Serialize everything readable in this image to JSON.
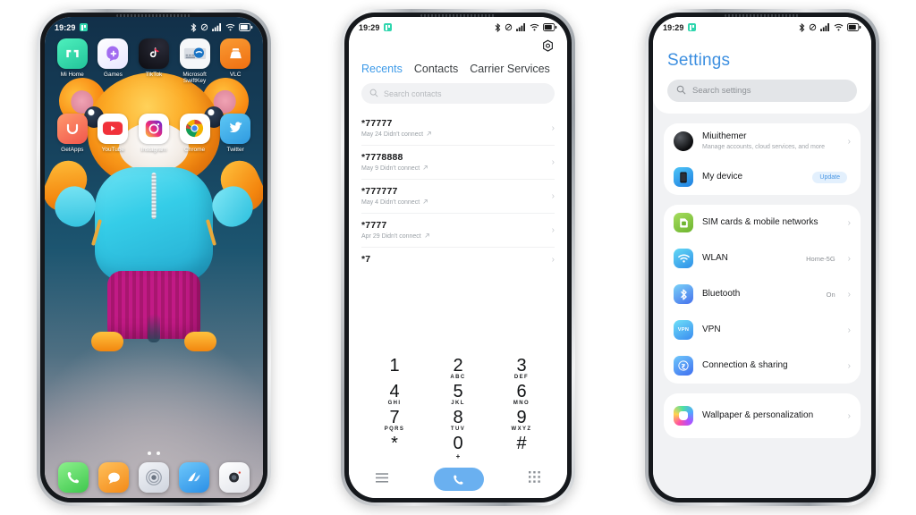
{
  "meta": {
    "background_color": "#ffffff",
    "accent_blue": "#3d9ae8"
  },
  "status_bar": {
    "time": "19:29",
    "icons": [
      "bluetooth-icon",
      "silent-mode-icon",
      "signal-icon",
      "wifi-icon",
      "battery-icon"
    ]
  },
  "phone1_home": {
    "app_rows": [
      [
        {
          "label": "Mi Home",
          "icon": "mi-home-icon",
          "color": "#2fd9a8"
        },
        {
          "label": "Games",
          "icon": "games-icon",
          "color": "#ffffff"
        },
        {
          "label": "TikTok",
          "icon": "tiktok-icon",
          "color": "#101014"
        },
        {
          "label": "Microsoft SwiftKey",
          "icon": "swiftkey-icon",
          "color": "#ffffff"
        },
        {
          "label": "VLC",
          "icon": "vlc-icon",
          "color": "#f57c1f"
        }
      ],
      [
        {
          "label": "GetApps",
          "icon": "getapps-icon",
          "color": "#f3714d"
        },
        {
          "label": "YouTube",
          "icon": "youtube-icon",
          "color": "#ffffff"
        },
        {
          "label": "Instagram",
          "icon": "instagram-icon",
          "color": "#ffffff"
        },
        {
          "label": "Chrome",
          "icon": "chrome-icon",
          "color": "#ffffff"
        },
        {
          "label": "Twitter",
          "icon": "twitter-icon",
          "color": "#37a7e8"
        }
      ]
    ],
    "page_dots": 2,
    "dock": [
      {
        "name": "phone-app",
        "icon": "phone-icon",
        "color": "#5fd45f"
      },
      {
        "name": "messages-app",
        "icon": "message-icon",
        "color": "#f7a02b"
      },
      {
        "name": "settings-app",
        "icon": "gear-icon",
        "color": "#e6e8ee"
      },
      {
        "name": "browser-app",
        "icon": "browser-icon",
        "color": "#3fa9f5"
      },
      {
        "name": "camera-app",
        "icon": "camera-icon",
        "color": "#f4f4f6"
      }
    ],
    "wallpaper": {
      "description": "orange teddy bear in cyan hoodie and magenta shorts",
      "bg_color": "#16415c",
      "fur_color": "#f4870f",
      "hoodie_color": "#2ab6d8",
      "shorts_color": "#c21a86"
    }
  },
  "phone2_dialer": {
    "settings_icon": "gear-icon",
    "tabs": [
      {
        "label": "Recents",
        "active": true
      },
      {
        "label": "Contacts",
        "active": false
      },
      {
        "label": "Carrier Services",
        "active": false
      }
    ],
    "search": {
      "placeholder": "Search contacts",
      "icon": "search-icon"
    },
    "calls": [
      {
        "number": "*77777",
        "detail": "May 24 Didn't connect"
      },
      {
        "number": "*7778888",
        "detail": "May 9 Didn't connect"
      },
      {
        "number": "*777777",
        "detail": "May 4 Didn't connect"
      },
      {
        "number": "*7777",
        "detail": "Apr 29 Didn't connect"
      },
      {
        "number": "*7",
        "detail": ""
      }
    ],
    "keypad": [
      {
        "digit": "1",
        "letters": ""
      },
      {
        "digit": "2",
        "letters": "ABC"
      },
      {
        "digit": "3",
        "letters": "DEF"
      },
      {
        "digit": "4",
        "letters": "GHI"
      },
      {
        "digit": "5",
        "letters": "JKL"
      },
      {
        "digit": "6",
        "letters": "MNO"
      },
      {
        "digit": "7",
        "letters": "PQRS"
      },
      {
        "digit": "8",
        "letters": "TUV"
      },
      {
        "digit": "9",
        "letters": "WXYZ"
      },
      {
        "digit": "*",
        "letters": ""
      },
      {
        "digit": "0",
        "letters": "+"
      },
      {
        "digit": "#",
        "letters": ""
      }
    ],
    "bottom_bar": {
      "menu_icon": "menu-icon",
      "call_button_icon": "phone-icon",
      "call_button_color": "#6ab0f0",
      "keypad_icon": "dialpad-icon"
    }
  },
  "phone3_settings": {
    "title": "Settings",
    "search": {
      "placeholder": "Search settings",
      "icon": "search-icon"
    },
    "groups": [
      {
        "items": [
          {
            "title": "Miuithemer",
            "subtitle": "Manage accounts, cloud services, and more",
            "icon": "account-avatar-icon",
            "icon_color": "#1a1a1a",
            "value": "",
            "badge": ""
          },
          {
            "title": "My device",
            "subtitle": "",
            "icon": "device-icon",
            "icon_color": "#2f9df4",
            "value": "",
            "badge": "Update"
          }
        ]
      },
      {
        "items": [
          {
            "title": "SIM cards & mobile networks",
            "subtitle": "",
            "icon": "sim-card-icon",
            "icon_color": "#7ec242",
            "value": "",
            "badge": ""
          },
          {
            "title": "WLAN",
            "subtitle": "",
            "icon": "wifi-icon",
            "icon_color": "#3fb6e8",
            "value": "Home-5G",
            "badge": ""
          },
          {
            "title": "Bluetooth",
            "subtitle": "",
            "icon": "bluetooth-icon",
            "icon_color": "#4a8df0",
            "value": "On",
            "badge": ""
          },
          {
            "title": "VPN",
            "subtitle": "",
            "icon": "vpn-icon",
            "icon_color": "#46c8f0",
            "value": "",
            "badge": ""
          },
          {
            "title": "Connection & sharing",
            "subtitle": "",
            "icon": "link-icon",
            "icon_color": "#4f9bf5",
            "value": "",
            "badge": ""
          }
        ]
      },
      {
        "items": [
          {
            "title": "Wallpaper & personalization",
            "subtitle": "",
            "icon": "wallpaper-icon",
            "icon_color": "#d24ad0",
            "value": "",
            "badge": ""
          }
        ]
      }
    ]
  }
}
